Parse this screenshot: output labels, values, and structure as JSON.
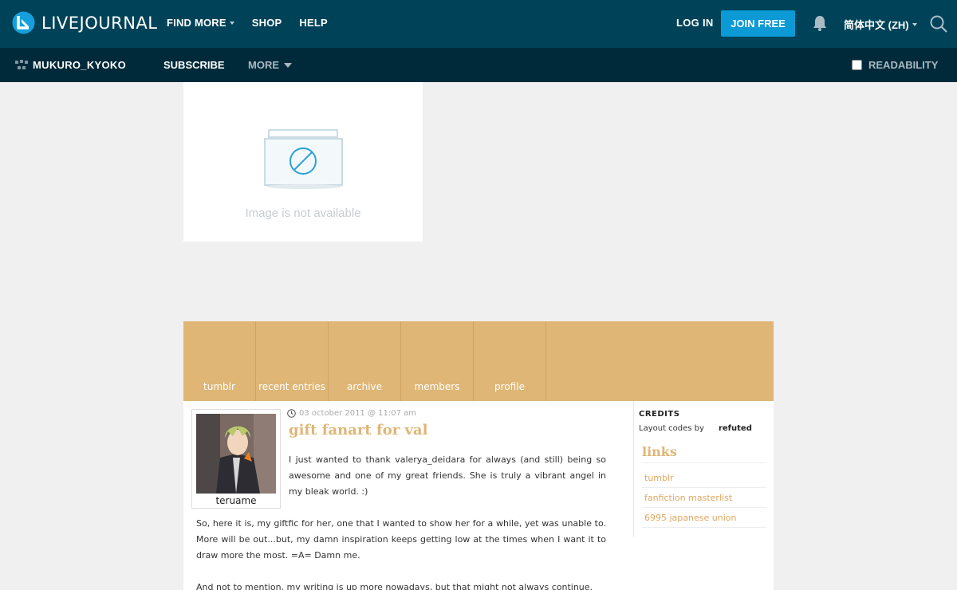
{
  "topbar": {
    "logo_text": "LIVEJOURNAL",
    "nav": [
      {
        "label": "FIND MORE",
        "has_caret": true
      },
      {
        "label": "SHOP",
        "has_caret": false
      },
      {
        "label": "HELP",
        "has_caret": false
      }
    ],
    "login_label": "LOG IN",
    "join_label": "JOIN FREE",
    "language_label": "简体中文 (ZH)",
    "icons": [
      "livejournal-logo-icon",
      "bell-icon",
      "search-icon"
    ]
  },
  "subbar": {
    "username": "MUKURO_KYOKO",
    "subscribe_label": "SUBSCRIBE",
    "more_label": "MORE",
    "readability_label": "READABILITY",
    "readability_checked": false
  },
  "image_placeholder": {
    "text": "Image is not available"
  },
  "journal_nav": [
    "tumblr",
    "recent entries",
    "archive",
    "members",
    "profile"
  ],
  "post": {
    "userpic_name": "teruame",
    "date": "03 october 2011 @ 11:07 am",
    "title": "gift fanart for val",
    "paragraphs": [
      "I just wanted to thank valerya_deidara for always (and still) being so awesome and one of my great friends. She is truly a vibrant angel in my bleak world. :)",
      "So, here it is, my giftfic for her, one that I wanted to show her for a while, yet was unable to. More will be out...but, my damn inspiration keeps getting low at the times when I want it to draw more the most. =A= Damn me.",
      "And not to mention, my writing is up more nowadays, but that might not always continue."
    ]
  },
  "sidebar": {
    "credits_heading": "CREDITS",
    "credits_text": "Layout codes by",
    "credits_author": "refuted",
    "links_heading": "links",
    "links": [
      "tumblr",
      "fanfiction masterlist",
      "6995 japanese union"
    ]
  },
  "colors": {
    "topbar": "#004359",
    "subbar": "#002a3a",
    "join_button": "#0b9ad6",
    "accent_gold": "#dfb676",
    "page_bg": "#f0f0f0"
  }
}
